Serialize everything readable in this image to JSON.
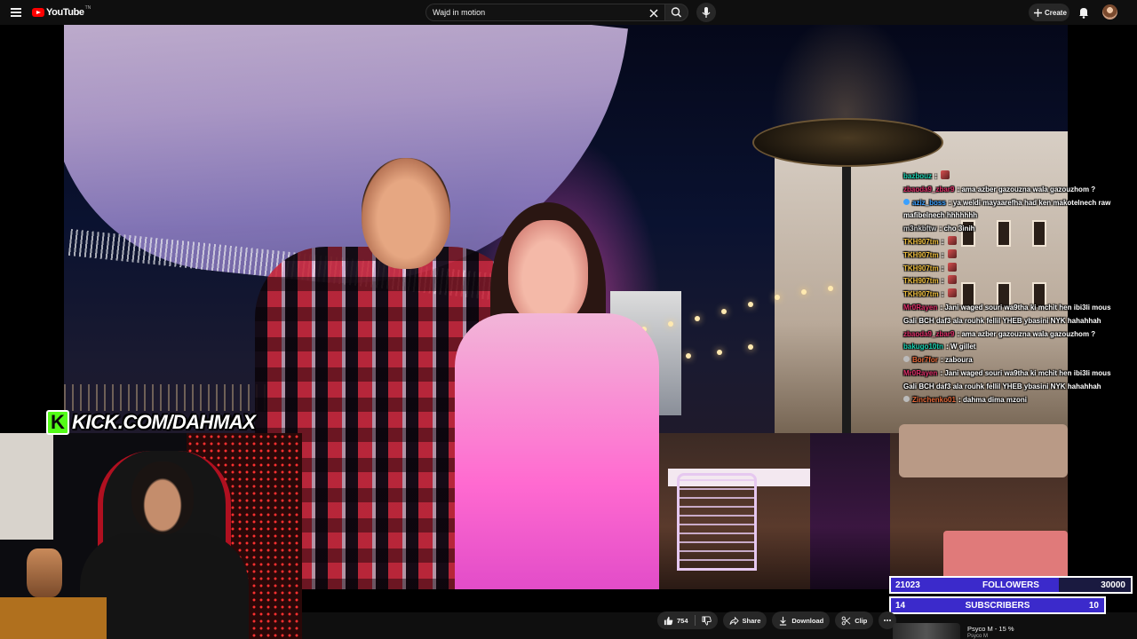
{
  "header": {
    "logo_text": "YouTube",
    "logo_tm": "TN",
    "search_value": "Wajd in motion",
    "create_label": "Create"
  },
  "overlay": {
    "kick_url": "KICK.COM/DAHMAX"
  },
  "chat": [
    {
      "user": "bazbouz",
      "user_color": "#1bd6b4",
      "text": "",
      "emote": true
    },
    {
      "user": "zbaoda9_zbar9",
      "user_color": "#e0306a",
      "text": "ama azber gazouzna wala gazouzhom ?",
      "emote": false
    },
    {
      "user": "aziz_boss",
      "user_color": "#3aa0ff",
      "text": "ya weldi mayaarefha had ken makotelnech raw mafibelnech hhhhhhh",
      "badge": "blue",
      "emote": false
    },
    {
      "user": "m3nkbftw",
      "user_color": "#d0d0d0",
      "text": "cho 3inih",
      "emote": false
    },
    {
      "user": "TKH907tm",
      "user_color": "#f0c040",
      "text": "",
      "emote": true
    },
    {
      "user": "TKH907tm",
      "user_color": "#f0c040",
      "text": "",
      "emote": true
    },
    {
      "user": "TKH907tm",
      "user_color": "#f0c040",
      "text": "",
      "emote": true
    },
    {
      "user": "TKH907tm",
      "user_color": "#f0c040",
      "text": "",
      "emote": true
    },
    {
      "user": "TKH907tm",
      "user_color": "#f0c040",
      "text": "",
      "emote": true
    },
    {
      "user": "Mr0Rayen",
      "user_color": "#e0306a",
      "text": "Jani waged souri wa9tha ki mchit hen ibi3li mous Gali BCH daf3 ala rouhk fellil YHEB ybasini NYK hahahhah",
      "emote": false
    },
    {
      "user": "zbaoda9_zbar9",
      "user_color": "#e0306a",
      "text": "ama azber gazouzna wala gazouzhom ?",
      "emote": false
    },
    {
      "user": "bakugo10tn",
      "user_color": "#1bd6b4",
      "text": "W gillet",
      "emote": false
    },
    {
      "user": "Bor7for",
      "user_color": "#e86a3a",
      "text": "zaboura",
      "badge": "grey",
      "emote": false
    },
    {
      "user": "Mr0Rayen",
      "user_color": "#e0306a",
      "text": "Jani waged souri wa9tha ki mchit hen ibi3li mous Gali BCH daf3 ala rouhk fellil YHEB ybasini NYK hahahhah",
      "emote": false
    },
    {
      "user": "Zinchenko01",
      "user_color": "#e86a3a",
      "text": "dahma dima mzoni",
      "badge": "grey",
      "emote": false
    }
  ],
  "goals": {
    "followers": {
      "current": "21023",
      "label": "FOLLOWERS",
      "target": "30000",
      "progress": 0.7
    },
    "subscribers": {
      "current": "14",
      "label": "SUBSCRIBERS",
      "target": "10",
      "progress": 1.0
    }
  },
  "actions": {
    "like_count": "754",
    "share_label": "Share",
    "download_label": "Download",
    "clip_label": "Clip"
  },
  "next_up": {
    "title": "Psyco M - 15 %",
    "channel": "Psyco M"
  },
  "colors": {
    "accent_red": "#ff0000",
    "kick_green": "#53fc18",
    "goal_fill": "#3b2acb"
  }
}
